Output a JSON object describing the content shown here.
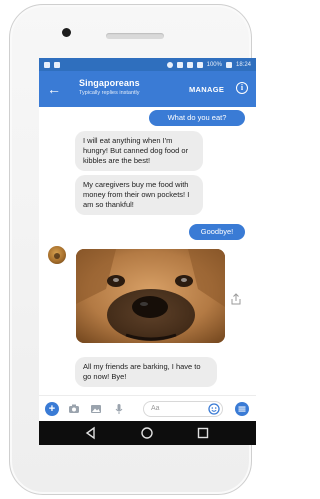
{
  "status_bar": {
    "battery": "100%",
    "time": "18:24"
  },
  "header": {
    "back_label": "←",
    "title": "Singaporeans",
    "subtitle": "Typically replies instantly",
    "manage_label": "MANAGE",
    "info_label": "i"
  },
  "messages": [
    {
      "id": "m1",
      "direction": "out",
      "text": "What do you eat?"
    },
    {
      "id": "m2",
      "direction": "in",
      "text": "I will eat anything when I'm hungry! But canned dog food or kibbles are the best!"
    },
    {
      "id": "m3",
      "direction": "in",
      "text": "My caregivers buy me food with money from their own pockets! I am so thankful!"
    },
    {
      "id": "m4",
      "direction": "out",
      "text": "Goodbye!"
    },
    {
      "id": "m5",
      "direction": "in",
      "type": "image",
      "alt_icon": "dog-photo"
    },
    {
      "id": "m6",
      "direction": "in",
      "text": "All my friends are barking, I have to go now! Bye!"
    }
  ],
  "composer": {
    "placeholder": "Aa",
    "icons": [
      "plus-icon",
      "camera-icon",
      "gallery-icon",
      "microphone-icon",
      "emoji-icon",
      "more-icon"
    ]
  },
  "colors": {
    "accent": "#3a7bd5",
    "statusbar": "#2f6fbe",
    "incoming_bubble": "#ececec"
  }
}
